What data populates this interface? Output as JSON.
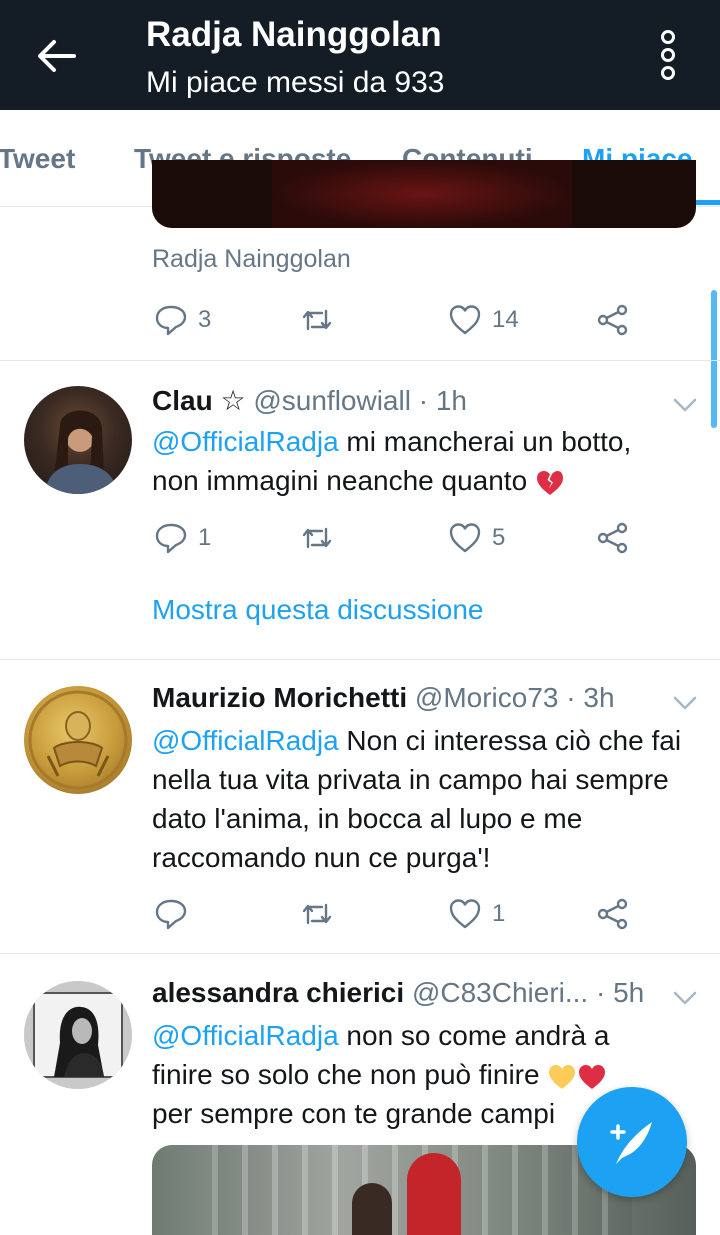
{
  "header": {
    "title": "Radja Nainggolan",
    "subtitle": "Mi piace messi da 933"
  },
  "tabs": [
    {
      "label": "Tweet"
    },
    {
      "label": "Tweet e risposte"
    },
    {
      "label": "Contenuti"
    },
    {
      "label": "Mi piace",
      "active": true
    }
  ],
  "previous_tweet": {
    "source_label": "Radja Nainggolan",
    "replies": "3",
    "retweets": "",
    "likes": "14"
  },
  "tweets": [
    {
      "name": "Clau ☆",
      "handle_time": "@sunflowiall · 1h",
      "mention": "@OfficialRadja",
      "text_line1": " mi mancherai un botto,",
      "text_line2": "non immagini neanche quanto ",
      "emoji": "broken-heart",
      "replies": "1",
      "retweets": "",
      "likes": "5",
      "thread_link": "Mostra questa discussione"
    },
    {
      "name": "Maurizio Morichetti",
      "handle_time": "@Morico73 · 3h",
      "mention": "@OfficialRadja",
      "text_line1": " Non ci interessa ciò che",
      "text_rest": "fai nella tua vita privata in campo hai sempre dato l'anima, in bocca al lupo e me raccomando nun ce purga'!",
      "replies": "",
      "retweets": "",
      "likes": "1"
    },
    {
      "name": "alessandra chierici",
      "handle": "@C83Chieri...",
      "time": "· 5h",
      "mention": "@OfficialRadja",
      "text_line1": " non so come andrà a",
      "text_line2": "finire so solo che non può finire ",
      "text_line3": "per sempre con te grande campi",
      "emojis": [
        "yellow-heart",
        "red-heart"
      ]
    }
  ],
  "colors": {
    "topbar": "#141d26",
    "accent": "#1da1f2",
    "secondary_text": "#657786"
  }
}
